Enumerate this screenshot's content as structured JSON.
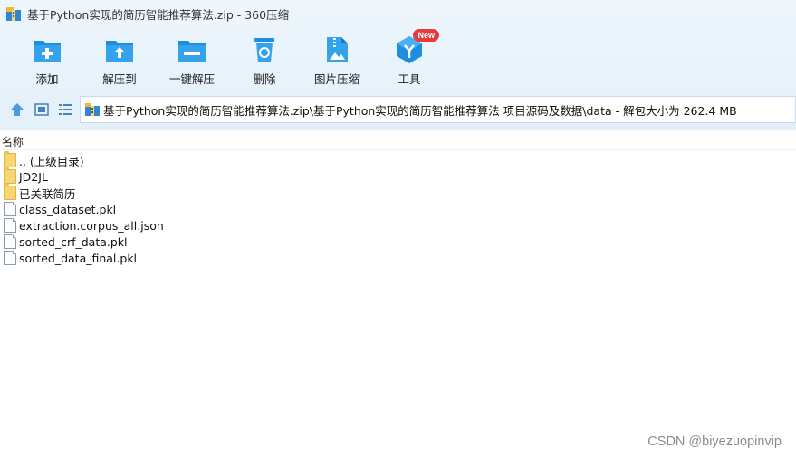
{
  "window": {
    "title": "基于Python实现的简历智能推荐算法.zip - 360压缩"
  },
  "toolbar": {
    "items": [
      {
        "label": "添加",
        "icon": "add-folder-icon"
      },
      {
        "label": "解压到",
        "icon": "extract-to-icon"
      },
      {
        "label": "一键解压",
        "icon": "one-click-extract-icon"
      },
      {
        "label": "删除",
        "icon": "recycle-bin-icon"
      },
      {
        "label": "图片压缩",
        "icon": "image-compress-icon"
      },
      {
        "label": "工具",
        "icon": "tools-icon",
        "badge": "New"
      }
    ]
  },
  "navbar": {
    "path": "基于Python实现的简历智能推荐算法.zip\\基于Python实现的简历智能推荐算法 项目源码及数据\\data - 解包大小为 262.4 MB"
  },
  "list": {
    "column_header": "名称",
    "rows": [
      {
        "name": ".. (上级目录)",
        "type": "folder"
      },
      {
        "name": "JD2JL",
        "type": "folder"
      },
      {
        "name": "已关联简历",
        "type": "folder"
      },
      {
        "name": "class_dataset.pkl",
        "type": "file"
      },
      {
        "name": "extraction.corpus_all.json",
        "type": "file"
      },
      {
        "name": "sorted_crf_data.pkl",
        "type": "file"
      },
      {
        "name": "sorted_data_final.pkl",
        "type": "file"
      }
    ]
  },
  "watermark": "CSDN @biyezuopinvip",
  "colors": {
    "accent": "#1e8fe0",
    "badge": "#e73a3a",
    "toolbar_bg": "#e9f3fb"
  }
}
